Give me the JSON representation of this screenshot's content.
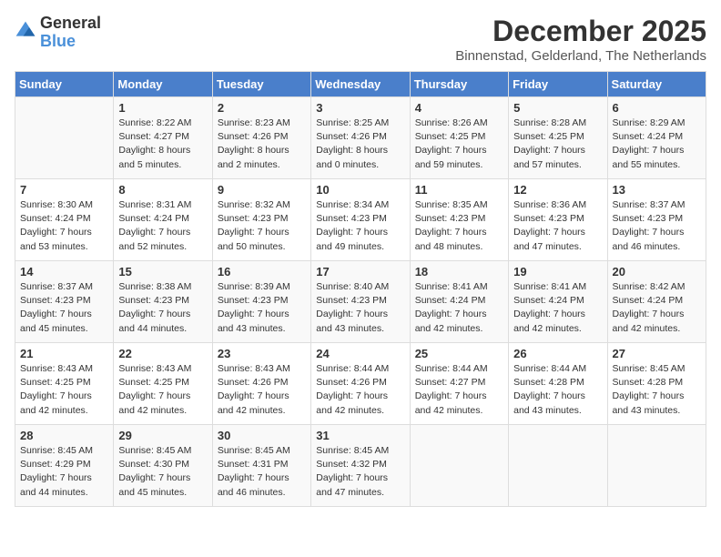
{
  "logo": {
    "general": "General",
    "blue": "Blue"
  },
  "header": {
    "month": "December 2025",
    "location": "Binnenstad, Gelderland, The Netherlands"
  },
  "days_of_week": [
    "Sunday",
    "Monday",
    "Tuesday",
    "Wednesday",
    "Thursday",
    "Friday",
    "Saturday"
  ],
  "weeks": [
    [
      {
        "day": "",
        "text": ""
      },
      {
        "day": "1",
        "text": "Sunrise: 8:22 AM\nSunset: 4:27 PM\nDaylight: 8 hours\nand 5 minutes."
      },
      {
        "day": "2",
        "text": "Sunrise: 8:23 AM\nSunset: 4:26 PM\nDaylight: 8 hours\nand 2 minutes."
      },
      {
        "day": "3",
        "text": "Sunrise: 8:25 AM\nSunset: 4:26 PM\nDaylight: 8 hours\nand 0 minutes."
      },
      {
        "day": "4",
        "text": "Sunrise: 8:26 AM\nSunset: 4:25 PM\nDaylight: 7 hours\nand 59 minutes."
      },
      {
        "day": "5",
        "text": "Sunrise: 8:28 AM\nSunset: 4:25 PM\nDaylight: 7 hours\nand 57 minutes."
      },
      {
        "day": "6",
        "text": "Sunrise: 8:29 AM\nSunset: 4:24 PM\nDaylight: 7 hours\nand 55 minutes."
      }
    ],
    [
      {
        "day": "7",
        "text": "Sunrise: 8:30 AM\nSunset: 4:24 PM\nDaylight: 7 hours\nand 53 minutes."
      },
      {
        "day": "8",
        "text": "Sunrise: 8:31 AM\nSunset: 4:24 PM\nDaylight: 7 hours\nand 52 minutes."
      },
      {
        "day": "9",
        "text": "Sunrise: 8:32 AM\nSunset: 4:23 PM\nDaylight: 7 hours\nand 50 minutes."
      },
      {
        "day": "10",
        "text": "Sunrise: 8:34 AM\nSunset: 4:23 PM\nDaylight: 7 hours\nand 49 minutes."
      },
      {
        "day": "11",
        "text": "Sunrise: 8:35 AM\nSunset: 4:23 PM\nDaylight: 7 hours\nand 48 minutes."
      },
      {
        "day": "12",
        "text": "Sunrise: 8:36 AM\nSunset: 4:23 PM\nDaylight: 7 hours\nand 47 minutes."
      },
      {
        "day": "13",
        "text": "Sunrise: 8:37 AM\nSunset: 4:23 PM\nDaylight: 7 hours\nand 46 minutes."
      }
    ],
    [
      {
        "day": "14",
        "text": "Sunrise: 8:37 AM\nSunset: 4:23 PM\nDaylight: 7 hours\nand 45 minutes."
      },
      {
        "day": "15",
        "text": "Sunrise: 8:38 AM\nSunset: 4:23 PM\nDaylight: 7 hours\nand 44 minutes."
      },
      {
        "day": "16",
        "text": "Sunrise: 8:39 AM\nSunset: 4:23 PM\nDaylight: 7 hours\nand 43 minutes."
      },
      {
        "day": "17",
        "text": "Sunrise: 8:40 AM\nSunset: 4:23 PM\nDaylight: 7 hours\nand 43 minutes."
      },
      {
        "day": "18",
        "text": "Sunrise: 8:41 AM\nSunset: 4:24 PM\nDaylight: 7 hours\nand 42 minutes."
      },
      {
        "day": "19",
        "text": "Sunrise: 8:41 AM\nSunset: 4:24 PM\nDaylight: 7 hours\nand 42 minutes."
      },
      {
        "day": "20",
        "text": "Sunrise: 8:42 AM\nSunset: 4:24 PM\nDaylight: 7 hours\nand 42 minutes."
      }
    ],
    [
      {
        "day": "21",
        "text": "Sunrise: 8:43 AM\nSunset: 4:25 PM\nDaylight: 7 hours\nand 42 minutes."
      },
      {
        "day": "22",
        "text": "Sunrise: 8:43 AM\nSunset: 4:25 PM\nDaylight: 7 hours\nand 42 minutes."
      },
      {
        "day": "23",
        "text": "Sunrise: 8:43 AM\nSunset: 4:26 PM\nDaylight: 7 hours\nand 42 minutes."
      },
      {
        "day": "24",
        "text": "Sunrise: 8:44 AM\nSunset: 4:26 PM\nDaylight: 7 hours\nand 42 minutes."
      },
      {
        "day": "25",
        "text": "Sunrise: 8:44 AM\nSunset: 4:27 PM\nDaylight: 7 hours\nand 42 minutes."
      },
      {
        "day": "26",
        "text": "Sunrise: 8:44 AM\nSunset: 4:28 PM\nDaylight: 7 hours\nand 43 minutes."
      },
      {
        "day": "27",
        "text": "Sunrise: 8:45 AM\nSunset: 4:28 PM\nDaylight: 7 hours\nand 43 minutes."
      }
    ],
    [
      {
        "day": "28",
        "text": "Sunrise: 8:45 AM\nSunset: 4:29 PM\nDaylight: 7 hours\nand 44 minutes."
      },
      {
        "day": "29",
        "text": "Sunrise: 8:45 AM\nSunset: 4:30 PM\nDaylight: 7 hours\nand 45 minutes."
      },
      {
        "day": "30",
        "text": "Sunrise: 8:45 AM\nSunset: 4:31 PM\nDaylight: 7 hours\nand 46 minutes."
      },
      {
        "day": "31",
        "text": "Sunrise: 8:45 AM\nSunset: 4:32 PM\nDaylight: 7 hours\nand 47 minutes."
      },
      {
        "day": "",
        "text": ""
      },
      {
        "day": "",
        "text": ""
      },
      {
        "day": "",
        "text": ""
      }
    ]
  ]
}
